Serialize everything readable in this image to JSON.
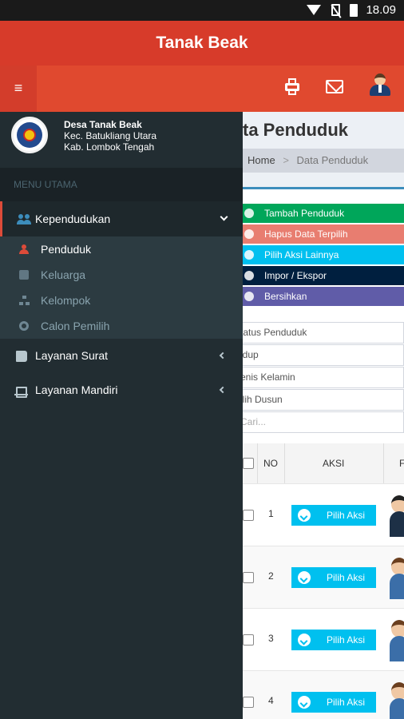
{
  "status_bar": {
    "time": "18.09"
  },
  "app_title": "Tanak Beak",
  "toolbar": {
    "menu_icon": "≡"
  },
  "main": {
    "page_title": "ta Penduduk",
    "breadcrumb": {
      "home": "Home",
      "sep": ">",
      "current": "Data Penduduk"
    },
    "actions": [
      {
        "label": "Tambah Penduduk",
        "color": "#00a65a"
      },
      {
        "label": "Hapus Data Terpilih",
        "color": "#e87d70"
      },
      {
        "label": "Pilih Aksi Lainnya",
        "color": "#00c0ef"
      },
      {
        "label": "Impor / Ekspor",
        "color": "#001f3f"
      },
      {
        "label": "Bersihkan",
        "color": "#605ca8"
      }
    ],
    "filters": [
      "tatus Penduduk",
      "idup",
      "enis Kelamin",
      "ilih Dusun"
    ],
    "search_placeholder": "Cari...",
    "table": {
      "headers": {
        "no": "NO",
        "aksi": "AKSI",
        "f": "F"
      },
      "rows": [
        {
          "no": "1",
          "action": "Pilih Aksi"
        },
        {
          "no": "2",
          "action": "Pilih Aksi"
        },
        {
          "no": "3",
          "action": "Pilih Aksi"
        },
        {
          "no": "4",
          "action": "Pilih Aksi"
        }
      ]
    }
  },
  "drawer": {
    "desa": "Desa Tanak Beak",
    "kecamatan": "Kec. Batukliang Utara",
    "kabupaten": "Kab. Lombok Tengah",
    "menu_header": "MENU UTAMA",
    "kependudukan": "Kependudukan",
    "submenu": [
      "Penduduk",
      "Keluarga",
      "Kelompok",
      "Calon Pemilih"
    ],
    "layanan_surat": "Layanan Surat",
    "layanan_mandiri": "Layanan Mandiri"
  },
  "colors": {
    "primary_red": "#d73b2a",
    "sidebar_dark": "#222d32",
    "accent_blue": "#00c0ef"
  }
}
